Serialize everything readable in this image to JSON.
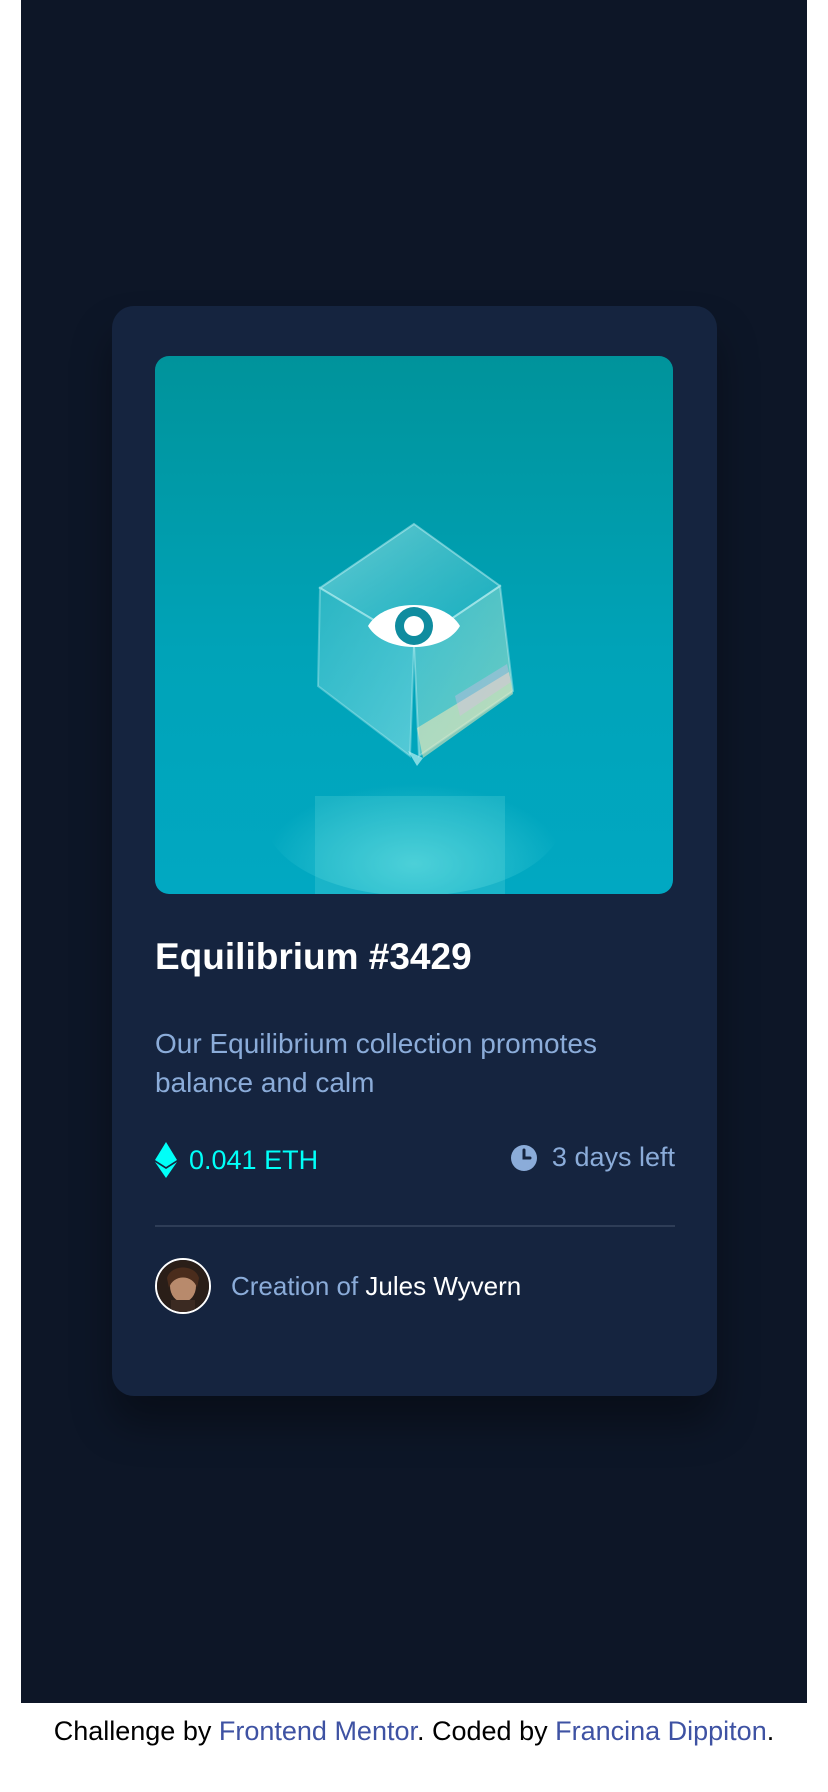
{
  "card": {
    "title": "Equilibrium #3429",
    "description": "Our Equilibrium collection promotes balance and calm",
    "price": "0.041 ETH",
    "time_left": "3 days left",
    "creator_prefix": "Creation of",
    "creator_name": "Jules Wyvern",
    "hero_icon": "eye-icon",
    "price_icon": "ethereum-icon",
    "time_icon": "clock-icon"
  },
  "footer": {
    "prefix": "Challenge by",
    "link1": "Frontend Mentor",
    "middle": ". Coded by",
    "link2": "Francina Dippiton",
    "suffix": "."
  },
  "colors": {
    "page_bg": "#0d1627",
    "card_bg": "#15243f",
    "accent_cyan": "#00fff8",
    "soft_blue": "#8bacd9",
    "white": "#ffffff",
    "link": "#3e52a3"
  }
}
